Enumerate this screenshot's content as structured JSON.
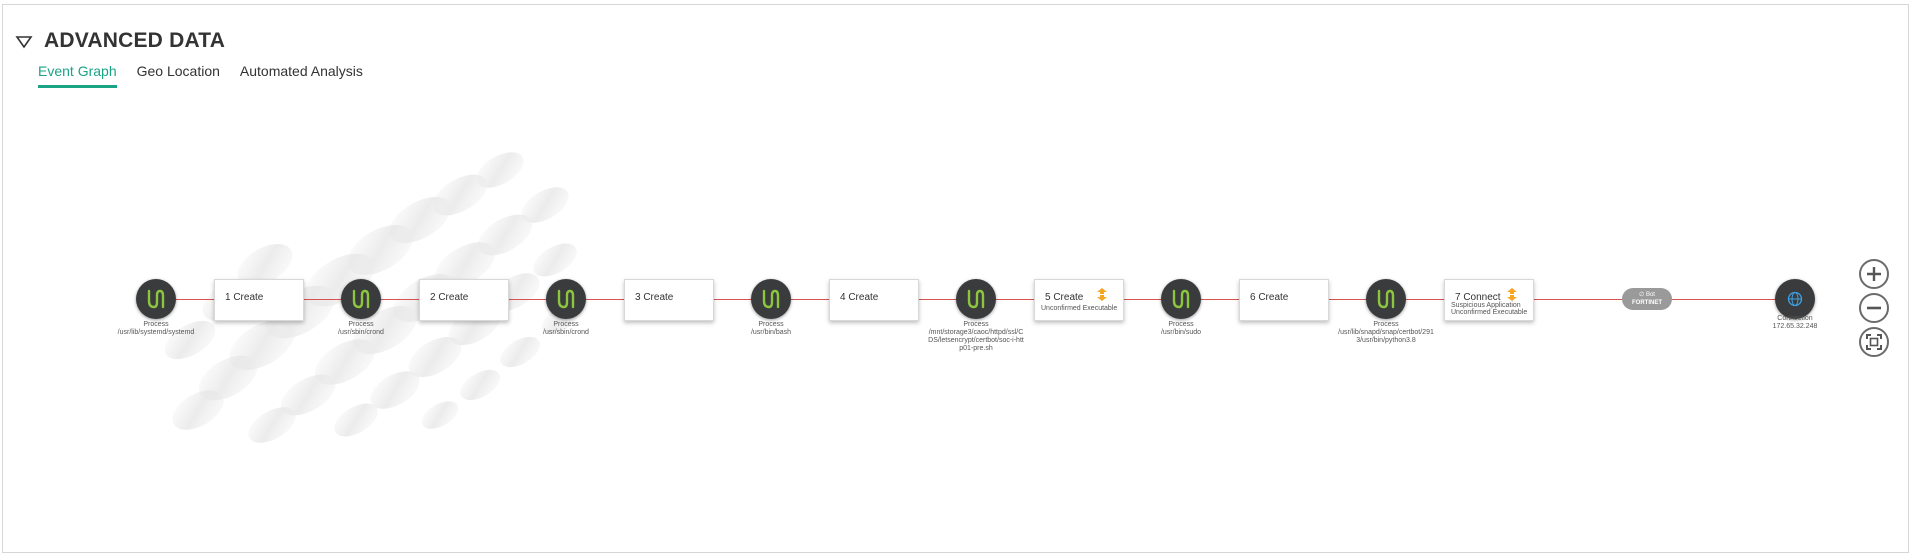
{
  "section": {
    "title": "ADVANCED DATA",
    "toggle_icon": "triangle-down-icon"
  },
  "tabs": [
    {
      "label": "Event Graph",
      "active": true
    },
    {
      "label": "Geo Location",
      "active": false
    },
    {
      "label": "Automated Analysis",
      "active": false
    }
  ],
  "graph": {
    "nodes": [
      {
        "type": "Process",
        "path": "/usr/lib/systemd/systemd"
      },
      {
        "type": "Process",
        "path": "/usr/sbin/crond"
      },
      {
        "type": "Process",
        "path": "/usr/sbin/crond"
      },
      {
        "type": "Process",
        "path": "/usr/bin/bash"
      },
      {
        "type": "Process",
        "path": "/mnt/storage3/caoc/httpd/ssl/CDS/letsencrypt/certbot/soc-i-http01-pre.sh"
      },
      {
        "type": "Process",
        "path": "/usr/bin/sudo"
      },
      {
        "type": "Process",
        "path": "/usr/lib/snapd/snap/certbot/2913/usr/bin/python3.8"
      }
    ],
    "events": [
      {
        "label": "1 Create",
        "sub": ""
      },
      {
        "label": "2 Create",
        "sub": ""
      },
      {
        "label": "3 Create",
        "sub": ""
      },
      {
        "label": "4 Create",
        "sub": ""
      },
      {
        "label": "5 Create",
        "sub": "Unconfirmed Executable"
      },
      {
        "label": "6 Create",
        "sub": ""
      },
      {
        "label": "7 Connect",
        "sub": "Suspicious Application\nUnconfirmed Executable"
      }
    ],
    "fortinet_badge": {
      "line1": "∅ Bot",
      "line2": "FORTINET"
    },
    "connection": {
      "type": "Connection",
      "ip": "172.65.32.248"
    },
    "colors": {
      "edge": "#d9534f",
      "node": "#3a3b3c",
      "process_icon": "#8cc63f",
      "warning_icon": "#f5a623",
      "accent": "#1aa385"
    }
  },
  "zoom_controls": [
    "zoom-in-icon",
    "zoom-out-icon",
    "fit-to-screen-icon"
  ]
}
